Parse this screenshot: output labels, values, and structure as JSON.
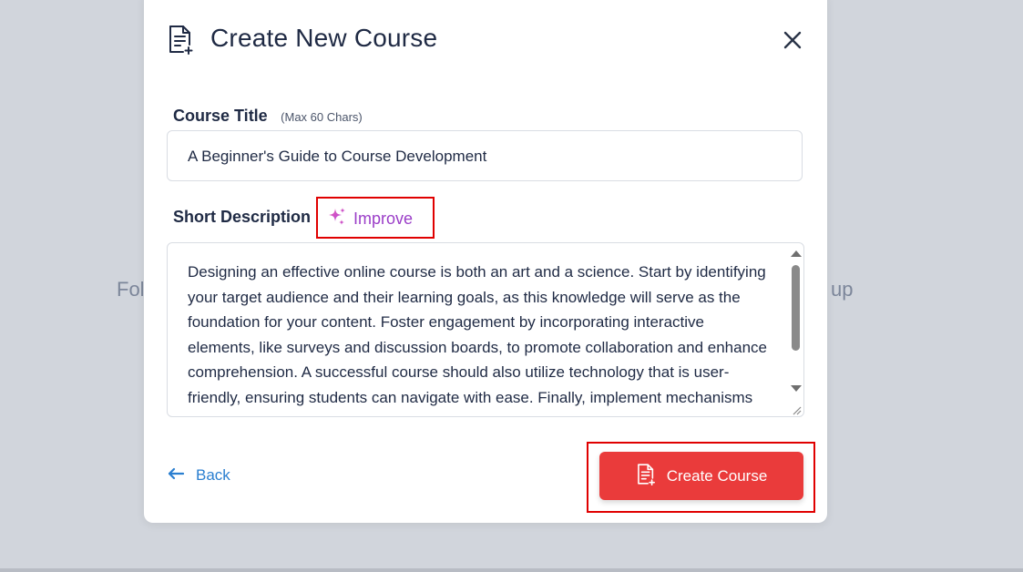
{
  "background": {
    "left_text": "Fol",
    "right_text": "up"
  },
  "modal": {
    "title": "Create New Course",
    "header_icon": "document-plus-icon",
    "close_icon": "close-icon"
  },
  "course_title": {
    "label": "Course Title",
    "hint": "(Max 60 Chars)",
    "value": "A Beginner's Guide to Course Development"
  },
  "description": {
    "label": "Short Description",
    "improve_label": "Improve",
    "improve_icon": "sparkle-icon",
    "value": "Designing an effective online course is both an art and a science. Start by identifying your target audience and their learning goals, as this knowledge will serve as the foundation for your content. Foster engagement by incorporating interactive elements, like surveys and discussion boards, to promote collaboration and enhance comprehension. A successful course should also utilize technology that is user-friendly, ensuring students can navigate with ease. Finally, implement mechanisms for feedback, allowing learners to share their perspectives and"
  },
  "footer": {
    "back_label": "Back",
    "create_label": "Create Course"
  },
  "colors": {
    "accent_red": "#ea3b3b",
    "link_blue": "#2b7fd0",
    "improve_purple": "#9b3ec8",
    "highlight_border": "#e00000"
  }
}
